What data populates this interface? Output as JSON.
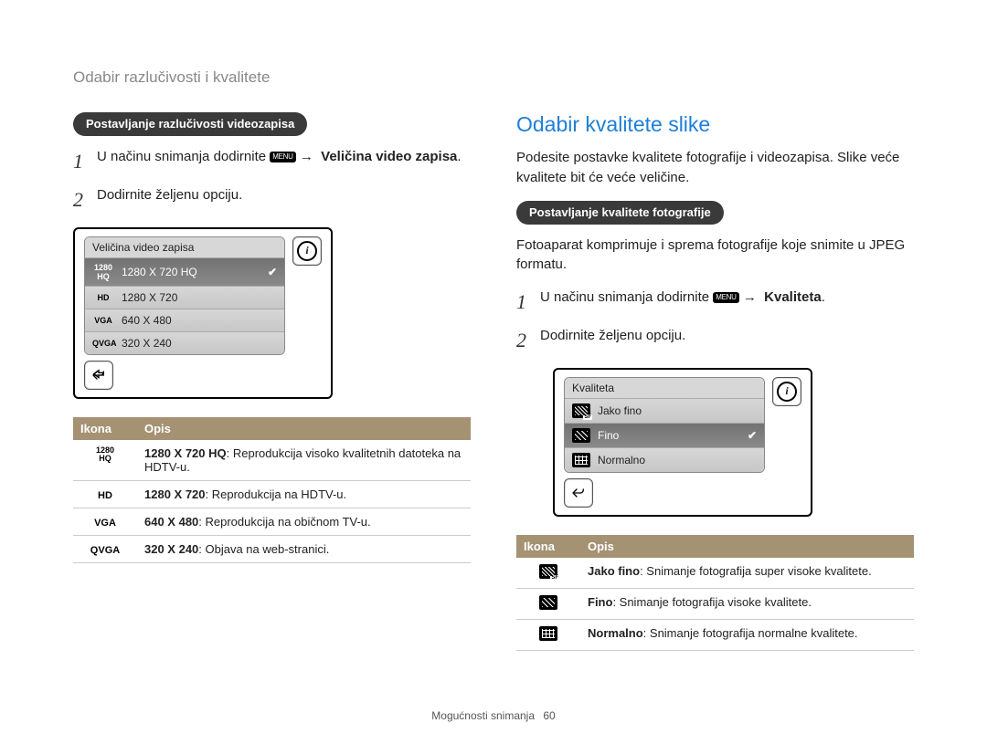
{
  "breadcrumb": "Odabir razlučivosti i kvalitete",
  "menu_chip": "MENU",
  "arrow": "→",
  "left": {
    "pill": "Postavljanje razlučivosti videozapisa",
    "step1_pre": "U načinu snimanja dodirnite ",
    "step1_post_bold": "Veličina video zapisa",
    "step2": "Dodirnite željenu opciju.",
    "device_title": "Veličina video zapisa",
    "device_items": [
      {
        "icon": "1280\nHQ",
        "label": "1280 X 720 HQ",
        "selected": true
      },
      {
        "icon": "HD",
        "label": "1280 X 720",
        "selected": false
      },
      {
        "icon": "VGA",
        "label": "640 X 480",
        "selected": false
      },
      {
        "icon": "QVGA",
        "label": "320 X 240",
        "selected": false
      }
    ],
    "table_head_icon": "Ikona",
    "table_head_desc": "Opis",
    "table_rows": [
      {
        "icon": "1280\nHQ",
        "bold": "1280 X 720 HQ",
        "rest": ": Reprodukcija visoko kvalitetnih datoteka na HDTV-u."
      },
      {
        "icon": "HD",
        "bold": "1280 X 720",
        "rest": ": Reprodukcija na HDTV-u."
      },
      {
        "icon": "VGA",
        "bold": "640 X 480",
        "rest": ": Reprodukcija na običnom TV-u."
      },
      {
        "icon": "QVGA",
        "bold": "320 X 240",
        "rest": ": Objava na web-stranici."
      }
    ]
  },
  "right": {
    "heading": "Odabir kvalitete slike",
    "intro": "Podesite postavke kvalitete fotografije i videozapisa. Slike veće kvalitete bit će veće veličine.",
    "pill": "Postavljanje kvalitete fotografije",
    "comp_text": "Fotoaparat komprimuje i sprema fotografije koje snimite u JPEG formatu.",
    "step1_pre": "U načinu snimanja dodirnite ",
    "step1_post_bold": "Kvaliteta",
    "step2": "Dodirnite željenu opciju.",
    "device_title": "Kvaliteta",
    "device_items": [
      {
        "q": "sf",
        "label": "Jako fino",
        "selected": false
      },
      {
        "q": "f",
        "label": "Fino",
        "selected": true
      },
      {
        "q": "n",
        "label": "Normalno",
        "selected": false
      }
    ],
    "table_head_icon": "Ikona",
    "table_head_desc": "Opis",
    "table_rows": [
      {
        "q": "sf",
        "bold": "Jako fino",
        "rest": ": Snimanje fotografija super visoke kvalitete."
      },
      {
        "q": "f",
        "bold": "Fino",
        "rest": ": Snimanje fotografija visoke kvalitete."
      },
      {
        "q": "n",
        "bold": "Normalno",
        "rest": ": Snimanje fotografija normalne kvalitete."
      }
    ]
  },
  "footer_section": "Mogućnosti snimanja",
  "footer_page": "60"
}
